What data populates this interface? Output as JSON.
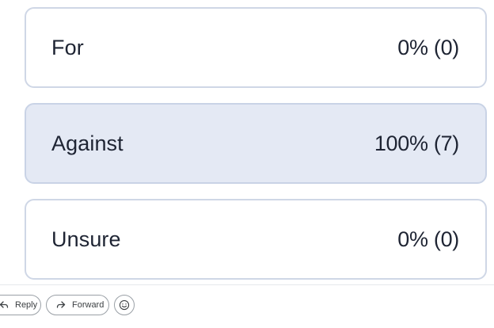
{
  "poll": {
    "options": [
      {
        "label": "For",
        "result": "0% (0)"
      },
      {
        "label": "Against",
        "result": "100% (7)"
      },
      {
        "label": "Unsure",
        "result": "0% (0)"
      }
    ]
  },
  "actions": {
    "reply_label": "Reply",
    "forward_label": "Forward",
    "reply_icon": "reply-arrow-icon",
    "forward_icon": "forward-arrow-icon",
    "emoji_icon": "smiley-face-icon"
  }
}
